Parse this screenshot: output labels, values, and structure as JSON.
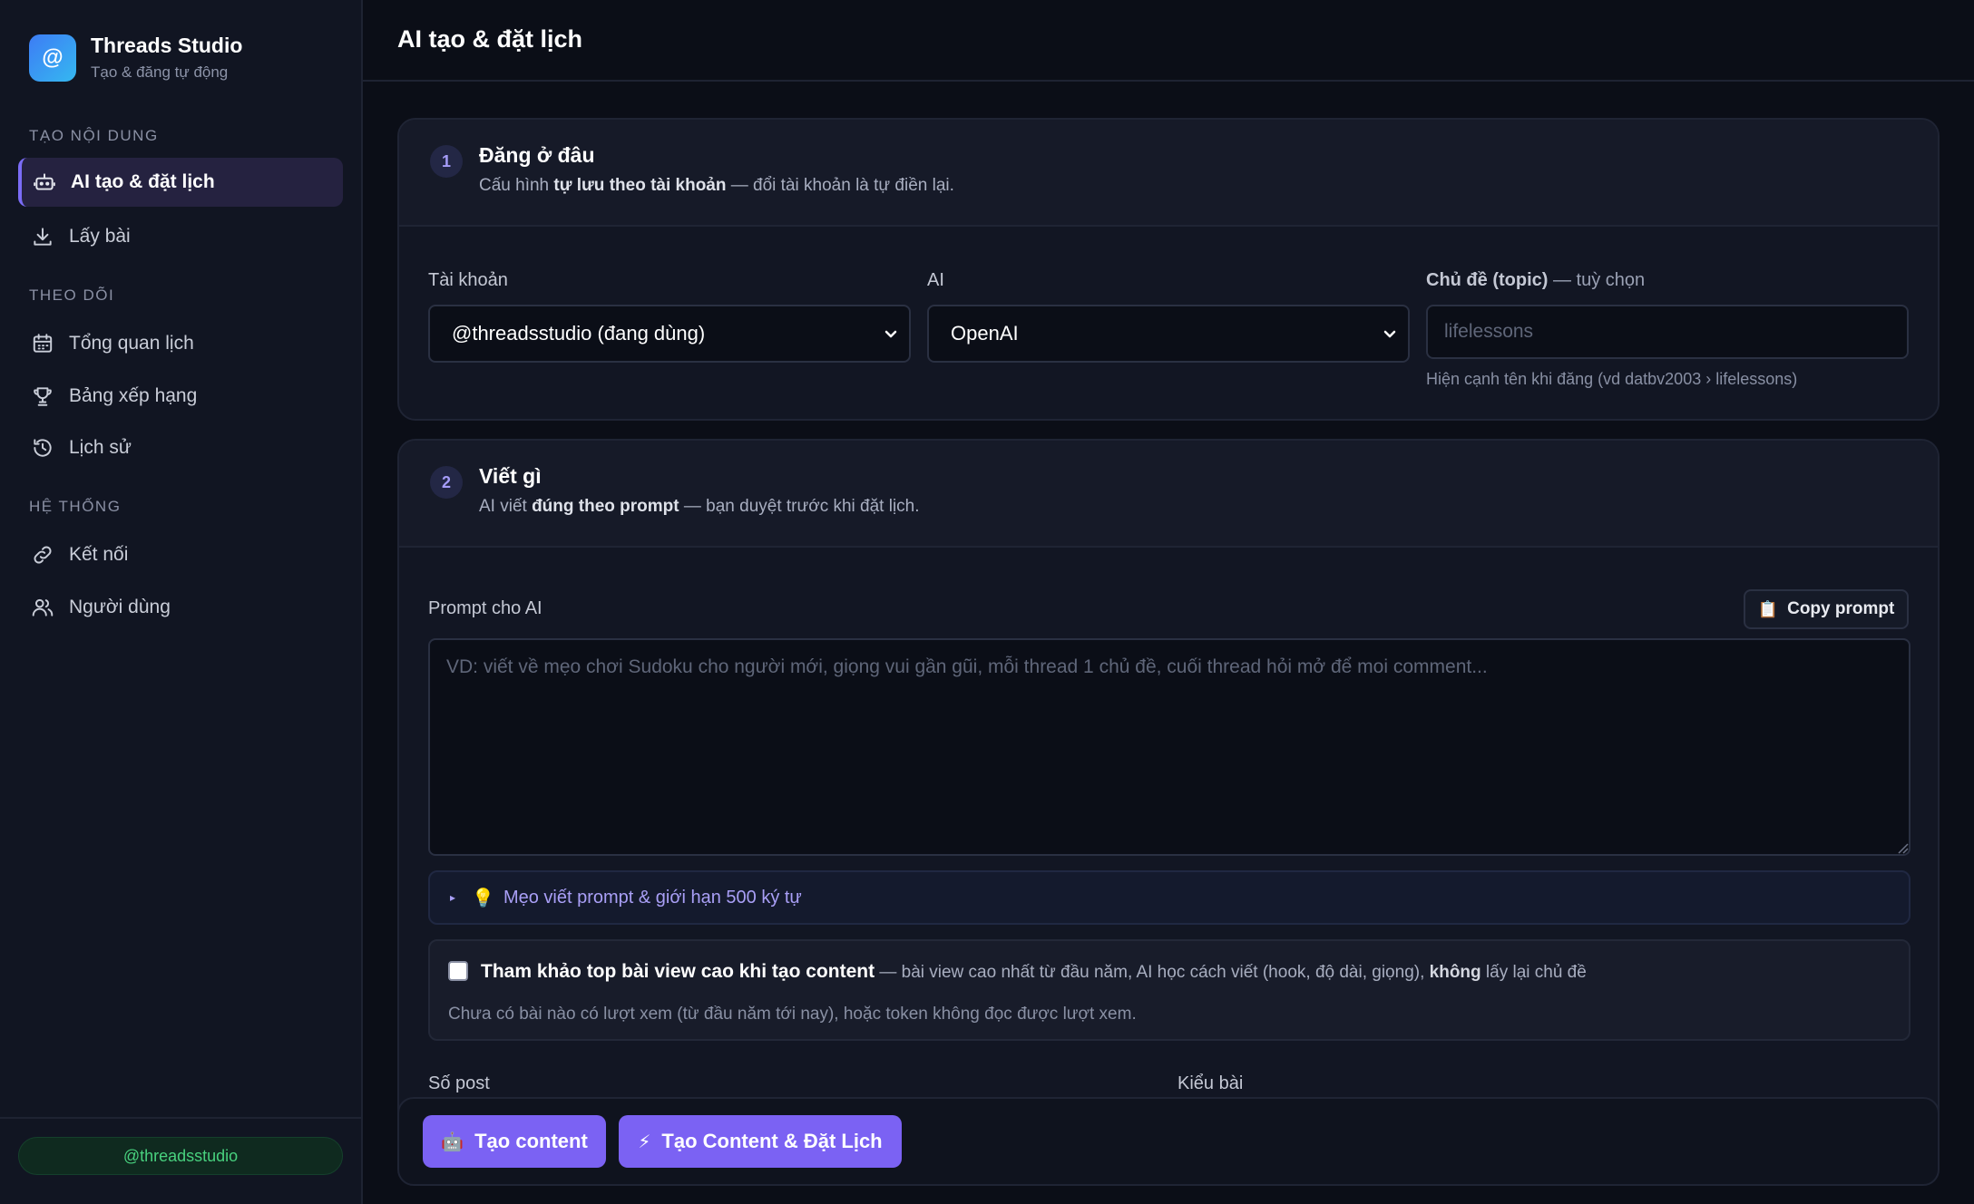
{
  "brand": {
    "logo": "@",
    "title": "Threads Studio",
    "subtitle": "Tạo & đăng tự động"
  },
  "sidebar": {
    "sections": [
      {
        "label": "TẠO NỘI DUNG"
      },
      {
        "label": "THEO DÕI"
      },
      {
        "label": "HỆ THỐNG"
      }
    ],
    "items": [
      {
        "label": "AI tạo & đặt lịch",
        "icon": "robot-icon"
      },
      {
        "label": "Lấy bài",
        "icon": "download-icon"
      },
      {
        "label": "Tổng quan lịch",
        "icon": "calendar-icon"
      },
      {
        "label": "Bảng xếp hạng",
        "icon": "trophy-icon"
      },
      {
        "label": "Lịch sử",
        "icon": "history-icon"
      },
      {
        "label": "Kết nối",
        "icon": "link-icon"
      },
      {
        "label": "Người dùng",
        "icon": "users-icon"
      }
    ],
    "user": "@threadsstudio"
  },
  "header": {
    "title": "AI tạo & đặt lịch"
  },
  "step1": {
    "number": "1",
    "title": "Đăng ở đâu",
    "sub_prefix": "Cấu hình ",
    "sub_bold": "tự lưu theo tài khoản",
    "sub_suffix": " — đổi tài khoản là tự điền lại.",
    "account_label": "Tài khoản",
    "account_value": "@threadsstudio (đang dùng)",
    "ai_label": "AI",
    "ai_value": "OpenAI",
    "topic_label": "Chủ đề (topic)",
    "topic_label_suffix": " — tuỳ chọn",
    "topic_placeholder": "lifelessons",
    "topic_hint": "Hiện cạnh tên khi đăng (vd datbv2003 › lifelessons)"
  },
  "step2": {
    "number": "2",
    "title": "Viết gì",
    "sub_prefix": "AI viết ",
    "sub_bold": "đúng theo prompt",
    "sub_suffix": " — bạn duyệt trước khi đặt lịch.",
    "prompt_label": "Prompt cho AI",
    "copy_button": "Copy prompt",
    "prompt_placeholder": "VD: viết về mẹo chơi Sudoku cho người mới, giọng vui gần gũi, mỗi thread 1 chủ đề, cuối thread hỏi mở để moi comment...",
    "tips": "Mẹo viết prompt & giới hạn 500 ký tự",
    "ref_title": "Tham khảo top bài view cao khi tạo content",
    "ref_desc_1": " — bài view cao nhất từ đầu năm, AI học cách viết (hook, độ dài, giọng), ",
    "ref_desc_bold": "không",
    "ref_desc_2": " lấy lại chủ đề",
    "ref_note": "Chưa có bài nào có lượt xem (từ đầu năm tới nay), hoặc token không đọc được lượt xem.",
    "post_count_label": "Số post",
    "post_type_label": "Kiểu bài"
  },
  "actions": {
    "create": "Tạo content",
    "create_schedule": "Tạo Content & Đặt Lịch"
  }
}
